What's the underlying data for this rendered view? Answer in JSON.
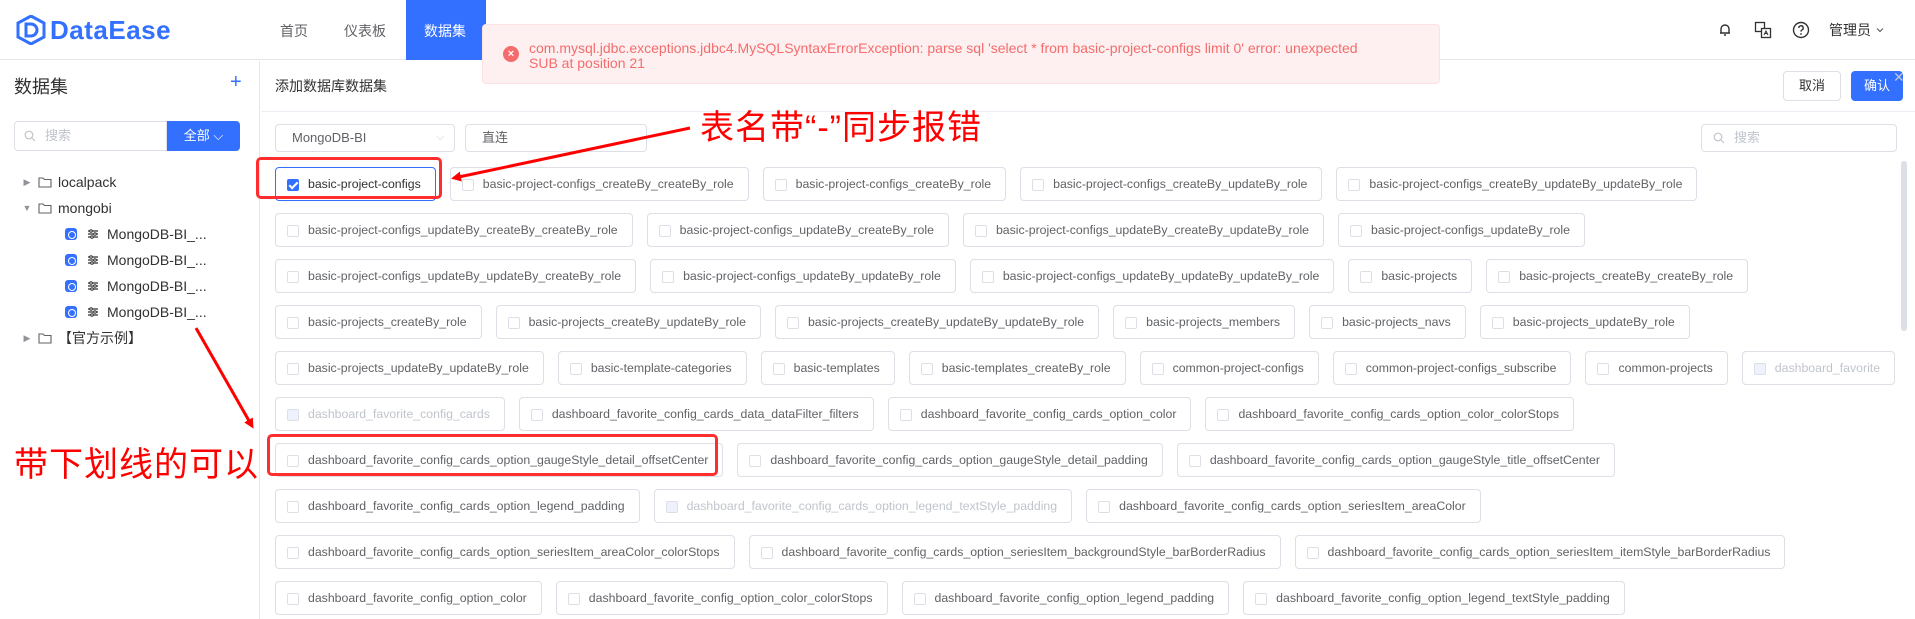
{
  "header": {
    "brand": "DataEase",
    "nav": [
      "首页",
      "仪表板",
      "数据集"
    ],
    "active_nav": 2,
    "user_name": "管理员",
    "colors": {
      "accent": "#3370ff",
      "error": "#f56c6c",
      "annotation": "#ff0000"
    }
  },
  "toast": {
    "message": "com.mysql.jdbc.exceptions.jdbc4.MySQLSyntaxErrorException: parse sql 'select * from basic-project-configs limit 0' error: unexpected SUB at position 21"
  },
  "sidebar": {
    "title": "数据集",
    "search_placeholder": "搜索",
    "filter_label": "全部",
    "tree": [
      {
        "label": "localpack",
        "type": "folder",
        "expanded": false
      },
      {
        "label": "mongobi",
        "type": "folder",
        "expanded": true,
        "children": [
          "MongoDB-BI_...",
          "MongoDB-BI_...",
          "MongoDB-BI_...",
          "MongoDB-BI_..."
        ]
      },
      {
        "label": "【官方示例】",
        "type": "folder",
        "expanded": false
      }
    ]
  },
  "main": {
    "title": "添加数据库数据集",
    "cancel_label": "取消",
    "confirm_label": "确认",
    "datasource_value": "MongoDB-BI",
    "mode_value": "直连",
    "search_placeholder": "搜索",
    "tables": [
      [
        {
          "name": "basic-project-configs",
          "state": "checked"
        },
        {
          "name": "basic-project-configs_createBy_createBy_role"
        },
        {
          "name": "basic-project-configs_createBy_role"
        },
        {
          "name": "basic-project-configs_createBy_updateBy_role"
        },
        {
          "name": "basic-project-configs_createBy_updateBy_updateBy_role"
        }
      ],
      [
        {
          "name": "basic-project-configs_updateBy_createBy_createBy_role"
        },
        {
          "name": "basic-project-configs_updateBy_createBy_role"
        },
        {
          "name": "basic-project-configs_updateBy_createBy_updateBy_role"
        },
        {
          "name": "basic-project-configs_updateBy_role"
        }
      ],
      [
        {
          "name": "basic-project-configs_updateBy_updateBy_createBy_role"
        },
        {
          "name": "basic-project-configs_updateBy_updateBy_role"
        },
        {
          "name": "basic-project-configs_updateBy_updateBy_updateBy_role"
        },
        {
          "name": "basic-projects"
        },
        {
          "name": "basic-projects_createBy_createBy_role"
        }
      ],
      [
        {
          "name": "basic-projects_createBy_role"
        },
        {
          "name": "basic-projects_createBy_updateBy_role"
        },
        {
          "name": "basic-projects_createBy_updateBy_updateBy_role"
        },
        {
          "name": "basic-projects_members"
        },
        {
          "name": "basic-projects_navs"
        },
        {
          "name": "basic-projects_updateBy_role"
        }
      ],
      [
        {
          "name": "basic-projects_updateBy_updateBy_role"
        },
        {
          "name": "basic-template-categories"
        },
        {
          "name": "basic-templates"
        },
        {
          "name": "basic-templates_createBy_role"
        },
        {
          "name": "common-project-configs"
        },
        {
          "name": "common-project-configs_subscribe"
        },
        {
          "name": "common-projects"
        },
        {
          "name": "dashboard_favorite",
          "state": "disabled"
        }
      ],
      [
        {
          "name": "dashboard_favorite_config_cards",
          "state": "disabled"
        },
        {
          "name": "dashboard_favorite_config_cards_data_dataFilter_filters"
        },
        {
          "name": "dashboard_favorite_config_cards_option_color"
        },
        {
          "name": "dashboard_favorite_config_cards_option_color_colorStops"
        }
      ],
      [
        {
          "name": "dashboard_favorite_config_cards_option_gaugeStyle_detail_offsetCenter"
        },
        {
          "name": "dashboard_favorite_config_cards_option_gaugeStyle_detail_padding"
        },
        {
          "name": "dashboard_favorite_config_cards_option_gaugeStyle_title_offsetCenter"
        }
      ],
      [
        {
          "name": "dashboard_favorite_config_cards_option_legend_padding"
        },
        {
          "name": "dashboard_favorite_config_cards_option_legend_textStyle_padding",
          "state": "disabled"
        },
        {
          "name": "dashboard_favorite_config_cards_option_seriesItem_areaColor"
        }
      ],
      [
        {
          "name": "dashboard_favorite_config_cards_option_seriesItem_areaColor_colorStops"
        },
        {
          "name": "dashboard_favorite_config_cards_option_seriesItem_backgroundStyle_barBorderRadius"
        },
        {
          "name": "dashboard_favorite_config_cards_option_seriesItem_itemStyle_barBorderRadius"
        }
      ],
      [
        {
          "name": "dashboard_favorite_config_option_color"
        },
        {
          "name": "dashboard_favorite_config_option_color_colorStops"
        },
        {
          "name": "dashboard_favorite_config_option_legend_padding"
        },
        {
          "name": "dashboard_favorite_config_option_legend_textStyle_padding"
        }
      ]
    ]
  },
  "annotations": {
    "top_note": "表名带“-”同步报错",
    "left_note": "带下划线的可以"
  }
}
